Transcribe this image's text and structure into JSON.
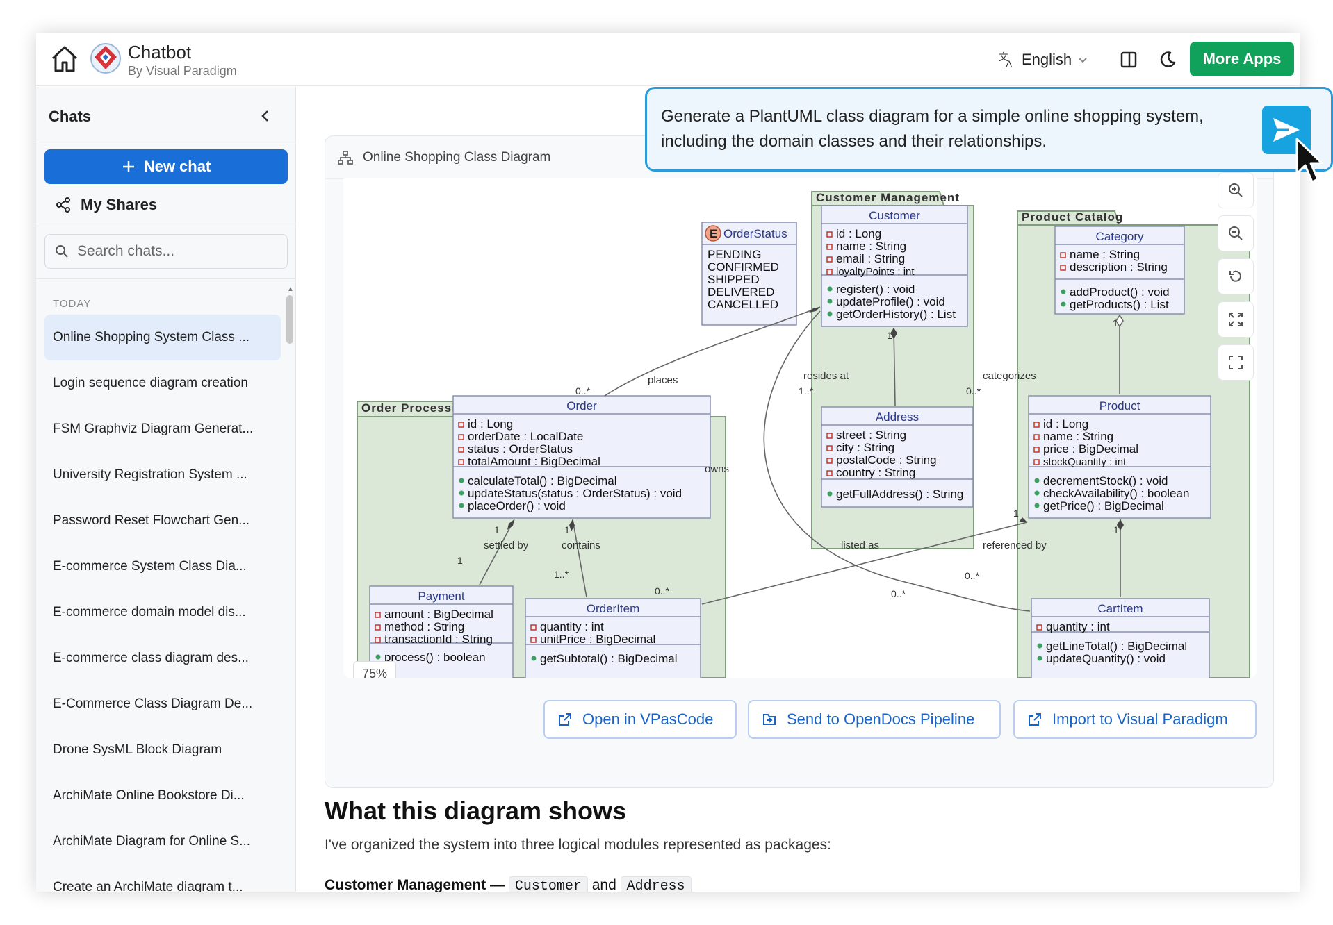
{
  "header": {
    "title": "Chatbot",
    "subtitle": "By Visual Paradigm",
    "language": "English",
    "more_apps": "More Apps"
  },
  "sidebar": {
    "header": "Chats",
    "new_chat": "New chat",
    "my_shares": "My Shares",
    "search_placeholder": "Search chats...",
    "section_label": "TODAY",
    "items": [
      {
        "label": "Online Shopping System Class ..."
      },
      {
        "label": "Login sequence diagram creation"
      },
      {
        "label": "FSM Graphviz Diagram Generat..."
      },
      {
        "label": "University Registration System ..."
      },
      {
        "label": "Password Reset Flowchart Gen..."
      },
      {
        "label": "E-commerce System Class Dia..."
      },
      {
        "label": "E-commerce domain model dis..."
      },
      {
        "label": "E-commerce class diagram des..."
      },
      {
        "label": "E-Commerce Class Diagram De..."
      },
      {
        "label": "Drone SysML Block Diagram"
      },
      {
        "label": "ArchiMate Online Bookstore Di..."
      },
      {
        "label": "ArchiMate Diagram for Online S..."
      },
      {
        "label": "Create an ArchiMate diagram t..."
      }
    ]
  },
  "prompt": {
    "text": "Generate a PlantUML class diagram for a simple online shopping system, including the domain classes and their relationships."
  },
  "card": {
    "title": "Online Shopping Class Diagram",
    "zoom": "75%"
  },
  "diagram": {
    "packages": {
      "customer_management": "Customer Management",
      "product_catalog": "Product Catalog",
      "order_processing": "Order Processing"
    },
    "enum": {
      "name": "OrderStatus",
      "marker": "E",
      "values": [
        "PENDING",
        "CONFIRMED",
        "SHIPPED",
        "DELIVERED",
        "CANCELLED"
      ]
    },
    "classes": {
      "customer": {
        "name": "Customer",
        "attrs": [
          "id : Long",
          "name : String",
          "email : String",
          "loyaltyPoints : int"
        ],
        "ops": [
          "register() : void",
          "updateProfile() : void",
          "getOrderHistory() : List"
        ]
      },
      "address": {
        "name": "Address",
        "attrs": [
          "street : String",
          "city : String",
          "postalCode : String",
          "country : String"
        ],
        "ops": [
          "getFullAddress() : String"
        ]
      },
      "category": {
        "name": "Category",
        "attrs": [
          "name : String",
          "description : String"
        ],
        "ops": [
          "addProduct() : void",
          "getProducts() : List"
        ]
      },
      "product": {
        "name": "Product",
        "attrs": [
          "id : Long",
          "name : String",
          "price : BigDecimal",
          "stockQuantity : int"
        ],
        "ops": [
          "decrementStock() : void",
          "checkAvailability() : boolean",
          "getPrice() : BigDecimal"
        ]
      },
      "order": {
        "name": "Order",
        "attrs": [
          "id : Long",
          "orderDate : LocalDate",
          "status : OrderStatus",
          "totalAmount : BigDecimal"
        ],
        "ops": [
          "calculateTotal() : BigDecimal",
          "updateStatus(status : OrderStatus) : void",
          "placeOrder() : void"
        ]
      },
      "payment": {
        "name": "Payment",
        "attrs": [
          "amount : BigDecimal",
          "method : String",
          "transactionId : String"
        ],
        "ops": [
          "process() : boolean"
        ]
      },
      "orderitem": {
        "name": "OrderItem",
        "attrs": [
          "quantity : int",
          "unitPrice : BigDecimal"
        ],
        "ops": [
          "getSubtotal() : BigDecimal"
        ]
      },
      "cartitem": {
        "name": "CartItem",
        "attrs": [
          "quantity : int"
        ],
        "ops": [
          "getLineTotal() : BigDecimal",
          "updateQuantity() : void"
        ]
      }
    },
    "labels": {
      "places": "places",
      "resides_at": "resides at",
      "categorizes": "categorizes",
      "owns": "owns",
      "settled_by": "settled by",
      "contains": "contains",
      "listed_as": "listed as",
      "referenced_by": "referenced by"
    },
    "multiplicities": {
      "one": "1",
      "zero_many": "0..*",
      "one_many": "1..*"
    }
  },
  "actions": {
    "open_vpascode": "Open in VPasCode",
    "send_opendocs": "Send to OpenDocs Pipeline",
    "import_vp": "Import to Visual Paradigm"
  },
  "content": {
    "heading": "What this diagram shows",
    "paragraph": "I've organized the system into three logical modules represented as packages:",
    "list_item_lead": "Customer Management —",
    "list_code_1": "Customer",
    "list_and": "and",
    "list_code_2": "Address"
  },
  "colors": {
    "primary_blue": "#1a6ed8",
    "green": "#10a15a",
    "package_fill": "#dbe8d8",
    "class_fill": "#eef0fb"
  }
}
